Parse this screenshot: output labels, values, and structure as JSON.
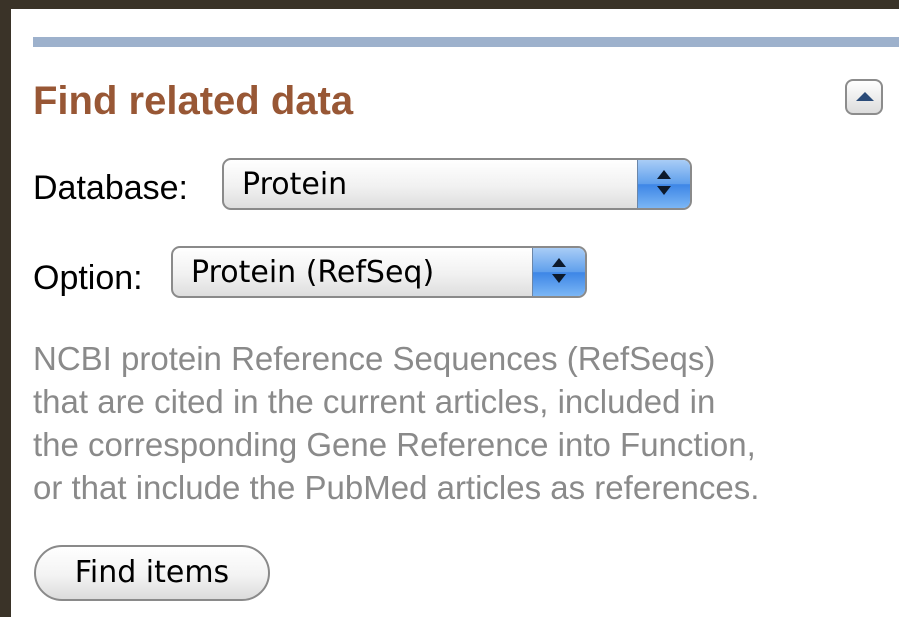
{
  "panel": {
    "title": "Find related data",
    "collapse_icon": "triangle-up-icon"
  },
  "database": {
    "label": "Database:",
    "selected": "Protein"
  },
  "option": {
    "label": "Option:",
    "selected": "Protein (RefSeq)"
  },
  "description": {
    "lines": [
      "NCBI protein Reference Sequences (RefSeqs)",
      "that are cited in the current articles, included in",
      "the corresponding Gene Reference into Function,",
      "or that include the PubMed articles as references."
    ]
  },
  "actions": {
    "find_label": "Find items"
  },
  "colors": {
    "title": "#985735",
    "rule": "#9db1cc",
    "description": "#8a8a8a",
    "frame": "#3a3328"
  }
}
